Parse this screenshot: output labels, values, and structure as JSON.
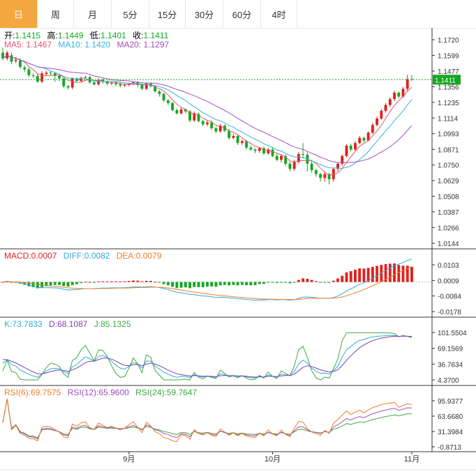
{
  "tabs": [
    {
      "label": "日",
      "active": true
    },
    {
      "label": "周"
    },
    {
      "label": "月"
    },
    {
      "label": "5分"
    },
    {
      "label": "15分"
    },
    {
      "label": "30分"
    },
    {
      "label": "60分"
    },
    {
      "label": "4时"
    }
  ],
  "ohlc_info": {
    "open_label": "开:",
    "open": "1.1415",
    "high_label": "高:",
    "high": "1.1449",
    "low_label": "低:",
    "low": "1.1401",
    "close_label": "收:",
    "close": "1.1411"
  },
  "ma_info": {
    "ma5": "MA5: 1.1467",
    "ma10": "MA10: 1.1420",
    "ma20": "MA20: 1.1297"
  },
  "macd_info": {
    "macd": "MACD:0.0007",
    "diff": "DIFF:0.0082",
    "dea": "DEA:0.0079"
  },
  "kdj_info": {
    "k": "K:73.7833",
    "d": "D:68.1087",
    "j": "J:85.1325"
  },
  "rsi_info": {
    "rsi6": "RSI(6):69.7575",
    "rsi12": "RSI(12):65.9600",
    "rsi24": "RSI(24):59.7647"
  },
  "colors": {
    "up": "#e0211d",
    "down": "#13a821",
    "ma5": "#e0566a",
    "ma10": "#32b4d8",
    "ma20": "#a14fb8",
    "macd": "#e0211d",
    "diff": "#35a8e0",
    "dea": "#f07c26",
    "k": "#35a8e0",
    "d": "#7a44a8",
    "j": "#3daa3d",
    "rsi6": "#f07c26",
    "rsi12": "#a14fb8",
    "rsi24": "#3daa3d",
    "tab_active": "#f4a640"
  },
  "chart_data": [
    {
      "type": "candlestick",
      "title": "",
      "yticks": [
        "1.1720",
        "1.1599",
        "1.1477",
        "1.1356",
        "1.1235",
        "1.1114",
        "1.0993",
        "1.0871",
        "1.0750",
        "1.0629",
        "1.0508",
        "1.0387",
        "1.0266",
        "1.0144"
      ],
      "ylim": [
        1.0144,
        1.172
      ],
      "last_price": "1.1411",
      "xticks": [
        {
          "label": "9月",
          "index": 29
        },
        {
          "label": "10月",
          "index": 62
        },
        {
          "label": "11月",
          "index": 94
        }
      ],
      "candles": [
        [
          1.162,
          1.1575,
          1.166,
          1.156
        ],
        [
          1.1575,
          1.162,
          1.1635,
          1.156
        ],
        [
          1.16,
          1.155,
          1.162,
          1.153
        ],
        [
          1.1555,
          1.1565,
          1.1585,
          1.154
        ],
        [
          1.156,
          1.151,
          1.1575,
          1.1495
        ],
        [
          1.1505,
          1.149,
          1.152,
          1.147
        ],
        [
          1.149,
          1.1445,
          1.1505,
          1.143
        ],
        [
          1.1445,
          1.144,
          1.146,
          1.1425
        ],
        [
          1.144,
          1.1395,
          1.1455,
          1.1385
        ],
        [
          1.1395,
          1.146,
          1.1475,
          1.1385
        ],
        [
          1.1455,
          1.1465,
          1.148,
          1.144
        ],
        [
          1.1465,
          1.146,
          1.148,
          1.144
        ],
        [
          1.146,
          1.144,
          1.147,
          1.1395
        ],
        [
          1.144,
          1.142,
          1.1455,
          1.14
        ],
        [
          1.142,
          1.136,
          1.143,
          1.1345
        ],
        [
          1.136,
          1.135,
          1.137,
          1.1335
        ],
        [
          1.135,
          1.142,
          1.143,
          1.1335
        ],
        [
          1.1415,
          1.14,
          1.143,
          1.1395
        ],
        [
          1.14,
          1.1425,
          1.1435,
          1.1395
        ],
        [
          1.1425,
          1.143,
          1.144,
          1.1415
        ],
        [
          1.143,
          1.139,
          1.144,
          1.138
        ],
        [
          1.139,
          1.1375,
          1.14,
          1.1365
        ],
        [
          1.1375,
          1.141,
          1.142,
          1.1365
        ],
        [
          1.141,
          1.1395,
          1.142,
          1.138
        ],
        [
          1.1395,
          1.138,
          1.1405,
          1.1365
        ],
        [
          1.138,
          1.1385,
          1.1395,
          1.137
        ],
        [
          1.1385,
          1.1375,
          1.14,
          1.136
        ],
        [
          1.1375,
          1.1365,
          1.139,
          1.135
        ],
        [
          1.1365,
          1.137,
          1.138,
          1.1355
        ],
        [
          1.137,
          1.138,
          1.1385,
          1.136
        ],
        [
          1.138,
          1.139,
          1.1395,
          1.137
        ],
        [
          1.139,
          1.137,
          1.14,
          1.1355
        ],
        [
          1.137,
          1.134,
          1.138,
          1.133
        ],
        [
          1.134,
          1.138,
          1.139,
          1.133
        ],
        [
          1.138,
          1.136,
          1.139,
          1.135
        ],
        [
          1.136,
          1.132,
          1.137,
          1.131
        ],
        [
          1.132,
          1.13,
          1.133,
          1.128
        ],
        [
          1.13,
          1.125,
          1.131,
          1.124
        ],
        [
          1.125,
          1.123,
          1.126,
          1.1215
        ],
        [
          1.123,
          1.1175,
          1.124,
          1.1165
        ],
        [
          1.1175,
          1.115,
          1.119,
          1.114
        ],
        [
          1.115,
          1.118,
          1.1195,
          1.114
        ],
        [
          1.118,
          1.1165,
          1.119,
          1.115
        ],
        [
          1.1165,
          1.1095,
          1.1175,
          1.108
        ],
        [
          1.1095,
          1.115,
          1.1165,
          1.1085
        ],
        [
          1.1145,
          1.109,
          1.1155,
          1.108
        ],
        [
          1.109,
          1.1065,
          1.11,
          1.105
        ],
        [
          1.1065,
          1.108,
          1.1095,
          1.105
        ],
        [
          1.108,
          1.1035,
          1.1095,
          1.102
        ],
        [
          1.1035,
          1.101,
          1.1045,
          1.0995
        ],
        [
          1.101,
          1.1055,
          1.107,
          1.1
        ],
        [
          1.1055,
          1.1015,
          1.1065,
          1.1005
        ],
        [
          1.1015,
          1.096,
          1.103,
          1.0945
        ],
        [
          1.096,
          1.0975,
          1.099,
          1.095
        ],
        [
          1.0975,
          1.092,
          1.0985,
          1.0905
        ],
        [
          1.092,
          1.0935,
          1.095,
          1.0905
        ],
        [
          1.0935,
          1.0885,
          1.0945,
          1.087
        ],
        [
          1.0885,
          1.087,
          1.09,
          1.086
        ],
        [
          1.087,
          1.086,
          1.088,
          1.084
        ],
        [
          1.086,
          1.088,
          1.089,
          1.0845
        ],
        [
          1.088,
          1.084,
          1.0895,
          1.083
        ],
        [
          1.084,
          1.087,
          1.088,
          1.083
        ],
        [
          1.087,
          1.082,
          1.089,
          1.081
        ],
        [
          1.082,
          1.079,
          1.084,
          1.078
        ],
        [
          1.079,
          1.082,
          1.0835,
          1.077
        ],
        [
          1.082,
          1.076,
          1.083,
          1.074
        ],
        [
          1.076,
          1.072,
          1.0775,
          1.07
        ],
        [
          1.072,
          1.0775,
          1.079,
          1.0705
        ],
        [
          1.0775,
          1.0835,
          1.085,
          1.076
        ],
        [
          1.0835,
          1.083,
          1.092,
          1.08
        ],
        [
          1.083,
          1.076,
          1.085,
          1.07
        ],
        [
          1.076,
          1.071,
          1.079,
          1.069
        ],
        [
          1.071,
          1.068,
          1.072,
          1.066
        ],
        [
          1.068,
          1.065,
          1.069,
          1.062
        ],
        [
          1.065,
          1.068,
          1.07,
          1.062
        ],
        [
          1.068,
          1.064,
          1.069,
          1.06
        ],
        [
          1.064,
          1.072,
          1.073,
          1.062
        ],
        [
          1.072,
          1.076,
          1.077,
          1.07
        ],
        [
          1.076,
          1.082,
          1.083,
          1.0745
        ],
        [
          1.082,
          1.09,
          1.091,
          1.081
        ],
        [
          1.09,
          1.087,
          1.0915,
          1.0855
        ],
        [
          1.087,
          1.092,
          1.0935,
          1.086
        ],
        [
          1.092,
          1.096,
          1.0975,
          1.091
        ],
        [
          1.096,
          1.094,
          1.097,
          1.0925
        ],
        [
          1.094,
          1.1,
          1.101,
          1.0935
        ],
        [
          1.1,
          1.106,
          1.1075,
          1.099
        ],
        [
          1.106,
          1.111,
          1.1125,
          1.105
        ],
        [
          1.111,
          1.117,
          1.1185,
          1.11
        ],
        [
          1.117,
          1.1215,
          1.123,
          1.1155
        ],
        [
          1.1215,
          1.126,
          1.1275,
          1.12
        ],
        [
          1.126,
          1.131,
          1.1325,
          1.1245
        ],
        [
          1.131,
          1.128,
          1.132,
          1.1265
        ],
        [
          1.128,
          1.134,
          1.1355,
          1.127
        ],
        [
          1.134,
          1.1415,
          1.1449,
          1.132
        ],
        [
          1.1415,
          1.1411,
          1.1449,
          1.1401
        ]
      ]
    },
    {
      "type": "bar",
      "name": "MACD",
      "yticks": [
        "0.0103",
        "0.0009",
        "-0.0084",
        "-0.0178"
      ],
      "ylim": [
        -0.0178,
        0.0103
      ]
    },
    {
      "type": "line",
      "name": "KDJ",
      "yticks": [
        "101.5504",
        "69.1569",
        "36.7634",
        "4.3700"
      ],
      "ylim": [
        4.37,
        101.5504
      ]
    },
    {
      "type": "line",
      "name": "RSI",
      "yticks": [
        "95.9377",
        "63.6680",
        "31.3984",
        "-0.8713"
      ],
      "ylim": [
        -0.8713,
        95.9377
      ]
    }
  ]
}
